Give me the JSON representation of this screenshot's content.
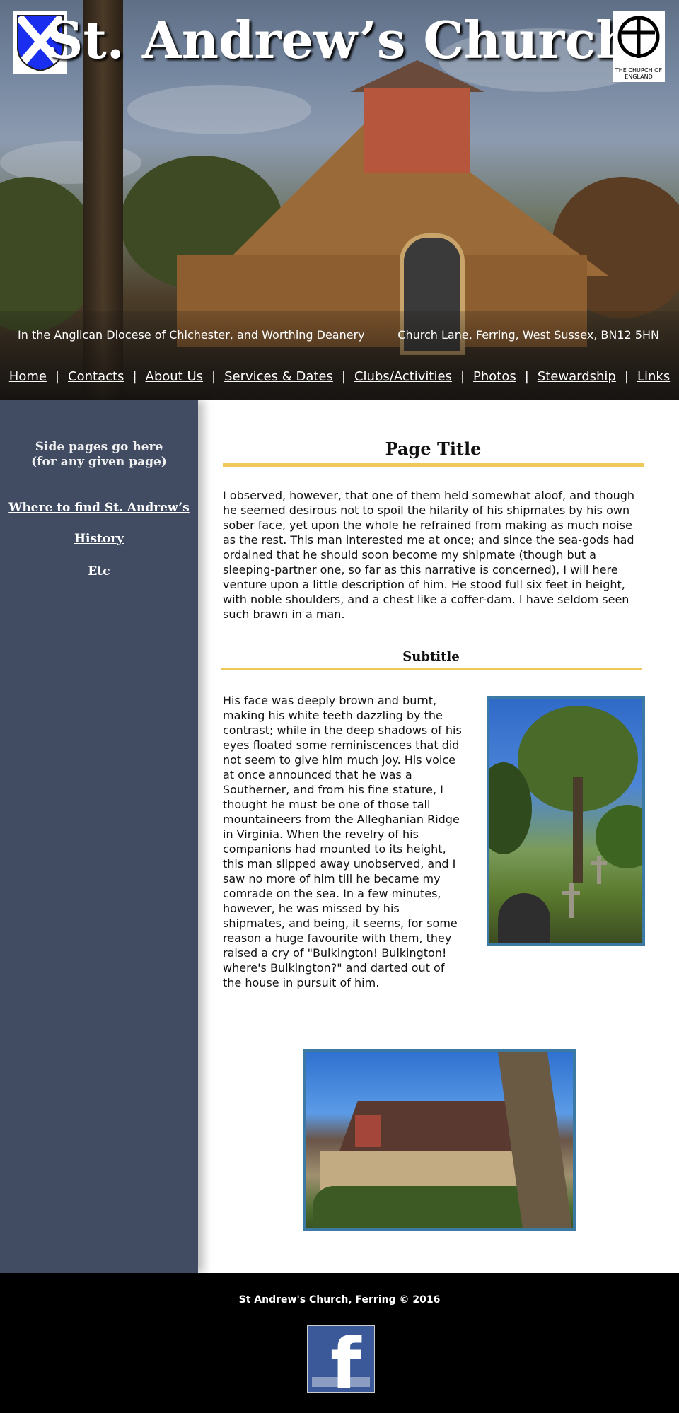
{
  "header": {
    "site_title": "St. Andrew’s Church",
    "crest_icon": "st-andrews-cross-shield",
    "coe_logo_icon": "church-of-england-cross",
    "coe_caption": "THE CHURCH OF ENGLAND",
    "tagline_left": "In the Anglican Diocese of Chichester, and Worthing Deanery",
    "tagline_right": "Church Lane, Ferring, West Sussex, BN12 5HN"
  },
  "nav": {
    "items": [
      {
        "label": "Home"
      },
      {
        "label": "Contacts"
      },
      {
        "label": "About Us"
      },
      {
        "label": "Services & Dates"
      },
      {
        "label": "Clubs/Activities"
      },
      {
        "label": "Photos"
      },
      {
        "label": "Stewardship"
      },
      {
        "label": "Links"
      }
    ],
    "separator": "|"
  },
  "sidebar": {
    "heading_line1": "Side pages go here",
    "heading_line2": "(for any given page)",
    "links": [
      {
        "label": "Where to find St. Andrew’s"
      },
      {
        "label": "History"
      },
      {
        "label": "Etc"
      }
    ]
  },
  "main": {
    "page_title": "Page Title",
    "paragraph1": "I observed, however, that one of them held somewhat aloof, and though he seemed desirous not to spoil the hilarity of his shipmates by his own sober face, yet upon the whole he refrained from making as much noise as the rest. This man interested me at once; and since the sea-gods had ordained that he should soon become my shipmate (though but a sleeping-partner one, so far as this narrative is concerned), I will here venture upon a little description of him. He stood full six feet in height, with noble shoulders, and a chest like a coffer-dam. I have seldom seen such brawn in a man.",
    "subtitle": "Subtitle",
    "paragraph2": "His face was deeply brown and burnt, making his white teeth dazzling by the contrast; while in the deep shadows of his eyes floated some reminiscences that did not seem to give him much joy. His voice at once announced that he was a Southerner, and from his fine stature, I thought he must be one of those tall mountaineers from the Alleghanian Ridge in Virginia. When the revelry of his companions had mounted to its height, this man slipped away unobserved, and I saw no more of him till he became my comrade on the sea. In a few minutes, however, he was missed by his shipmates, and being, it seems, for some reason a huge favourite with them, they raised a cry of \"Bulkington! Bulkington! where's Bulkington?\" and darted out of the house in pursuit of him."
  },
  "footer": {
    "copyright": "St Andrew's Church, Ferring © 2016",
    "facebook_icon": "facebook-logo"
  },
  "colors": {
    "sidebar_bg": "#414c62",
    "accent_rule": "#f0c85a",
    "photo_border": "#3c7aa3",
    "footer_bg": "#000000"
  }
}
